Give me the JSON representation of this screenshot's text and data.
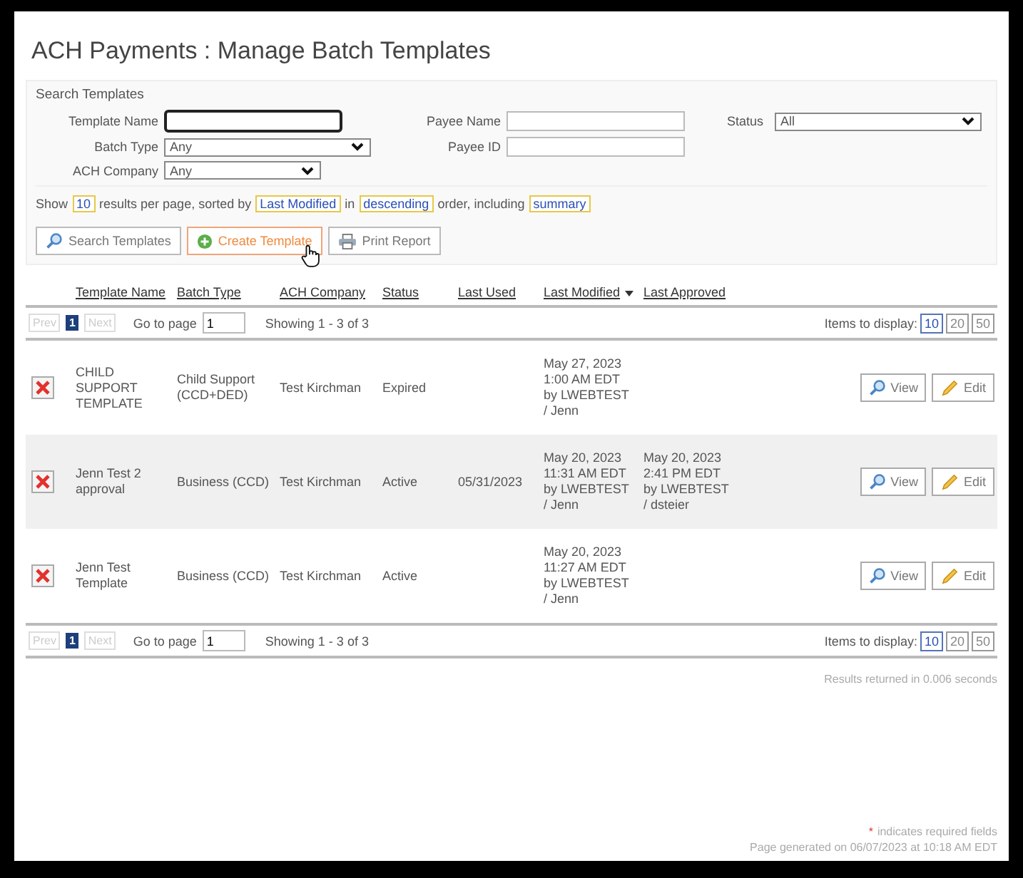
{
  "title": "ACH Payments : Manage Batch Templates",
  "search": {
    "legend": "Search Templates",
    "fields": [
      {
        "kind": "input",
        "label": "Template Name",
        "focused": true
      },
      {
        "kind": "input",
        "label": "Payee Name",
        "focused": false
      },
      {
        "kind": "select",
        "label": "Status",
        "value": "All"
      },
      {
        "kind": "select",
        "label": "Batch Type",
        "value": "Any"
      },
      {
        "kind": "input",
        "label": "Payee ID",
        "focused": false
      },
      {
        "kind": "select",
        "label": "ACH Company",
        "value": "Any"
      }
    ],
    "sentence": [
      {
        "kind": "text",
        "text": "Show"
      },
      {
        "kind": "option",
        "text": "10"
      },
      {
        "kind": "text",
        "text": "results per page, sorted by"
      },
      {
        "kind": "option",
        "text": "Last Modified"
      },
      {
        "kind": "text",
        "text": "in"
      },
      {
        "kind": "option",
        "text": "descending"
      },
      {
        "kind": "text",
        "text": "order, including"
      },
      {
        "kind": "option",
        "text": "summary"
      }
    ],
    "buttons": [
      {
        "kind": "search",
        "label": "Search Templates",
        "hovered": false
      },
      {
        "kind": "create",
        "label": "Create Template",
        "hovered": true
      },
      {
        "kind": "print",
        "label": "Print Report",
        "hovered": false
      }
    ]
  },
  "table": {
    "columns": [
      {
        "label": "Template Name",
        "sorted": false
      },
      {
        "label": "Batch Type",
        "sorted": false
      },
      {
        "label": "ACH Company",
        "sorted": false
      },
      {
        "label": "Status",
        "sorted": false
      },
      {
        "label": "Last Used",
        "sorted": false
      },
      {
        "label": "Last Modified",
        "sorted": true
      },
      {
        "label": "Last Approved",
        "sorted": false
      }
    ],
    "pagers": [
      {
        "prev": "Prev",
        "page": "1",
        "next": "Next",
        "goto_label": "Go to page",
        "goto_value": "1",
        "showing": "Showing 1 - 3 of 3",
        "items_label": "Items to display:",
        "sizes": [
          {
            "label": "10",
            "selected": true
          },
          {
            "label": "20",
            "selected": false
          },
          {
            "label": "50",
            "selected": false
          }
        ]
      },
      {
        "prev": "Prev",
        "page": "1",
        "next": "Next",
        "goto_label": "Go to page",
        "goto_value": "1",
        "showing": "Showing 1 - 3 of 3",
        "items_label": "Items to display:",
        "sizes": [
          {
            "label": "10",
            "selected": true
          },
          {
            "label": "20",
            "selected": false
          },
          {
            "label": "50",
            "selected": false
          }
        ]
      }
    ],
    "rows": [
      {
        "name": "CHILD SUPPORT TEMPLATE",
        "batch_type": "Child Support (CCD+DED)",
        "company": "Test Kirchman",
        "status": "Expired",
        "last_modified": "May 27, 2023 1:00 AM EDT by LWEBTEST / Jenn",
        "view": "View",
        "edit": "Edit",
        "shaded": false
      },
      {
        "name": "Jenn Test 2 approval",
        "batch_type": "Business (CCD)",
        "company": "Test Kirchman",
        "status": "Active",
        "last_used": "05/31/2023",
        "last_modified": "May 20, 2023 11:31 AM EDT by LWEBTEST / Jenn",
        "last_approved": "May 20, 2023 2:41 PM EDT by LWEBTEST / dsteier",
        "view": "View",
        "edit": "Edit",
        "shaded": true
      },
      {
        "name": "Jenn Test Template",
        "batch_type": "Business (CCD)",
        "company": "Test Kirchman",
        "status": "Active",
        "last_modified": "May 20, 2023 11:27 AM EDT by LWEBTEST / Jenn",
        "view": "View",
        "edit": "Edit",
        "shaded": false
      }
    ]
  },
  "results_note": "Results returned in 0.006 seconds",
  "required_mark": "*",
  "required_note": "indicates required fields",
  "generated": "Page generated on 06/07/2023 at 10:18 AM EDT"
}
